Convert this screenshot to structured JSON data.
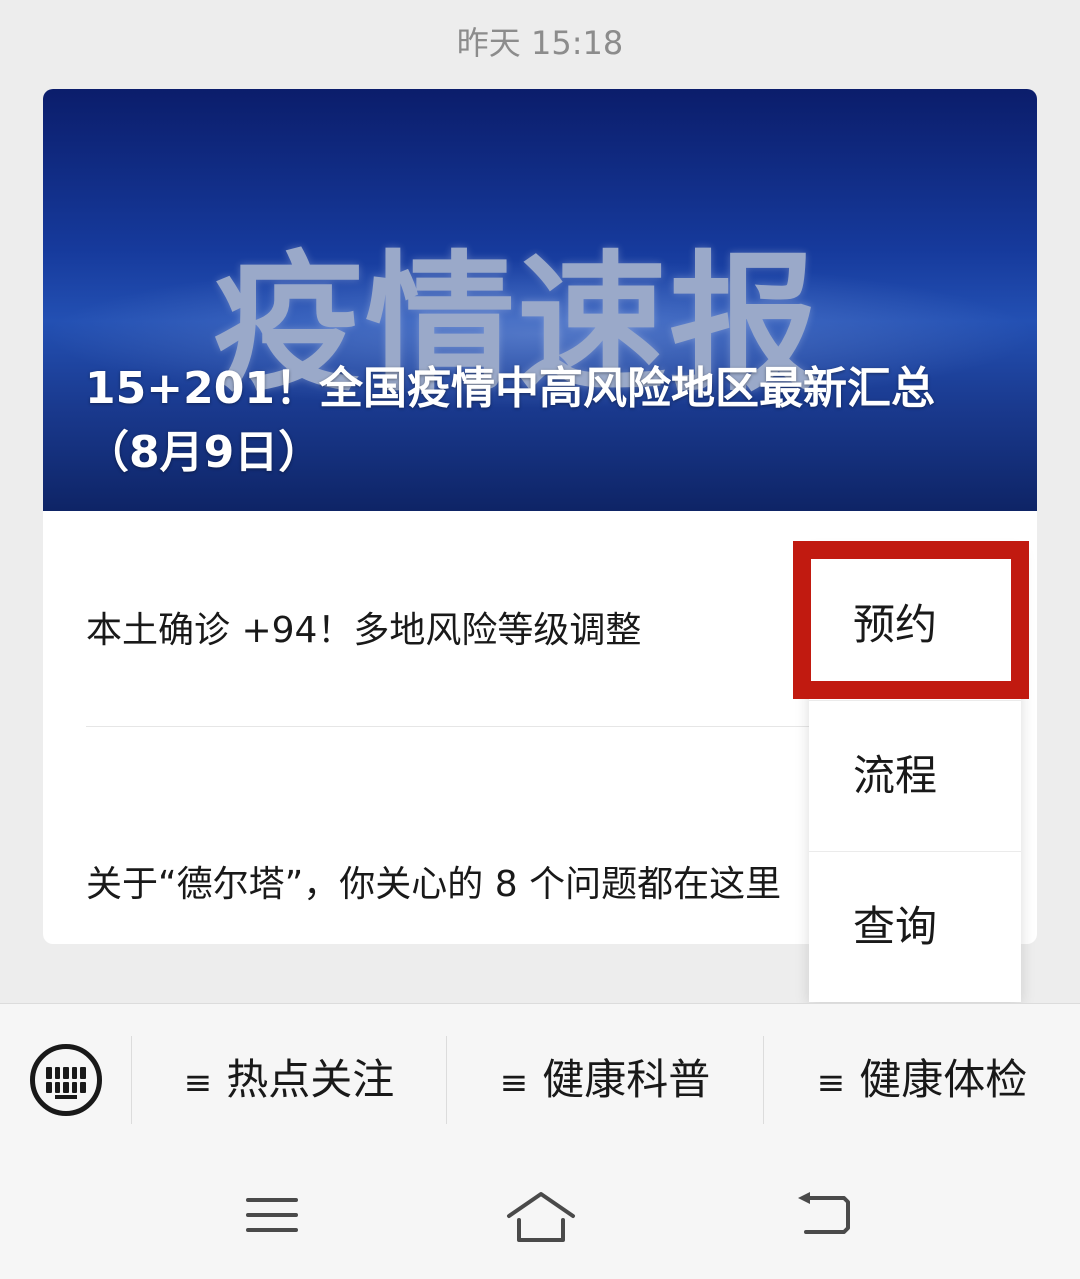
{
  "chat": {
    "timestamp": "昨天 15:18"
  },
  "article_card": {
    "cover_text": "疫情速报",
    "headline": "15+201！全国疫情中高风险地区最新汇总（8月9日）",
    "items": [
      {
        "title": "本土确诊 +94！多地风险等级调整"
      },
      {
        "title": "关于“德尔塔”，你关心的 8 个问题都在这里"
      }
    ]
  },
  "submenu": {
    "items": [
      {
        "label": "预约",
        "highlighted": true
      },
      {
        "label": "流程"
      },
      {
        "label": "查询"
      }
    ],
    "highlight_color": "#c11a10"
  },
  "menubar": {
    "keyboard_icon": "keyboard-icon",
    "items": [
      {
        "label": "热点关注"
      },
      {
        "label": "健康科普"
      },
      {
        "label": "健康体检"
      }
    ]
  },
  "navbar": {
    "icons": [
      "menu-icon",
      "home-icon",
      "back-icon"
    ]
  }
}
